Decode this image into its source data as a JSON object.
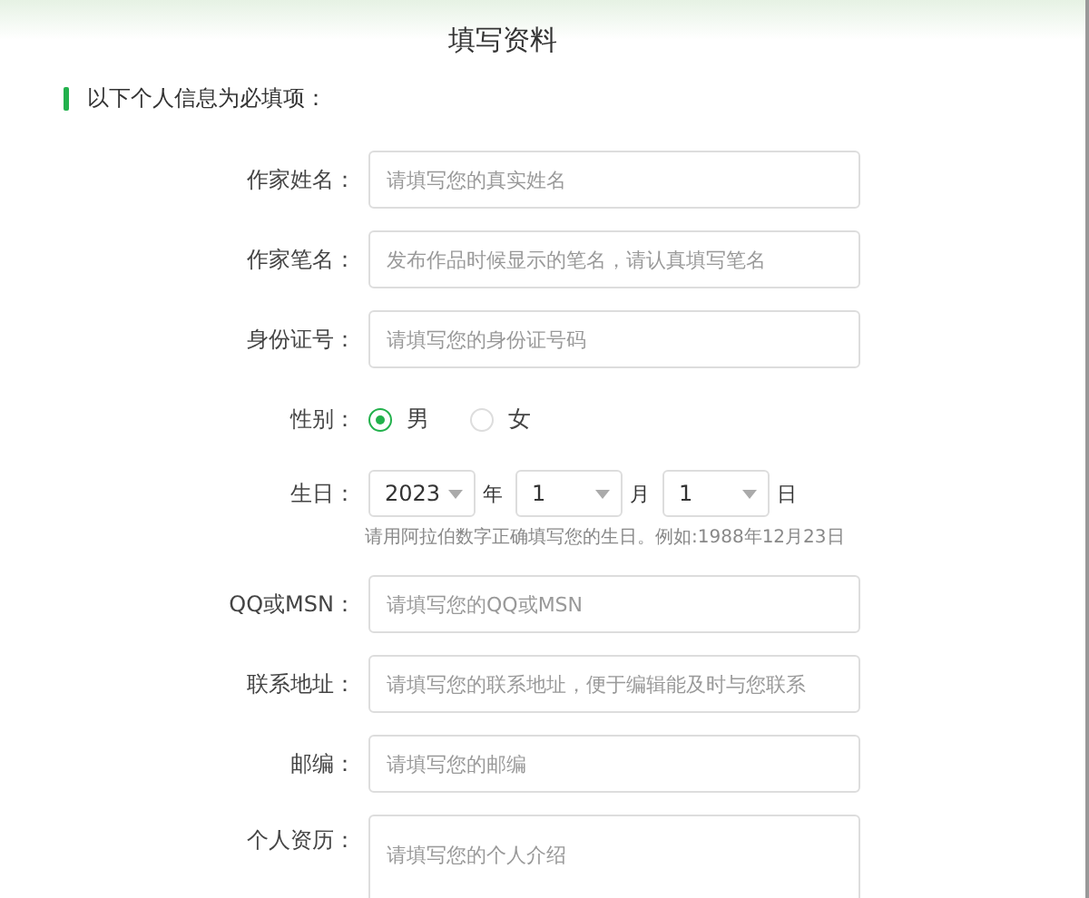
{
  "title": "填写资料",
  "section": "以下个人信息为必填项：",
  "fields": [
    {
      "kind": "text",
      "label": "作家姓名：",
      "placeholder": "请填写您的真实姓名"
    },
    {
      "kind": "text",
      "label": "作家笔名：",
      "placeholder": "发布作品时候显示的笔名，请认真填写笔名"
    },
    {
      "kind": "text",
      "label": "身份证号：",
      "placeholder": "请填写您的身份证号码"
    },
    {
      "kind": "radio",
      "label": "性别：",
      "options": [
        {
          "label": "男",
          "selected": true
        },
        {
          "label": "女",
          "selected": false
        }
      ]
    },
    {
      "kind": "date",
      "label": "生日：",
      "parts": [
        {
          "value": "2023",
          "unit": "年"
        },
        {
          "value": "1",
          "unit": "月"
        },
        {
          "value": "1",
          "unit": "日"
        }
      ],
      "hint": "请用阿拉伯数字正确填写您的生日。例如:1988年12月23日"
    },
    {
      "kind": "text",
      "label": "QQ或MSN：",
      "placeholder": "请填写您的QQ或MSN"
    },
    {
      "kind": "text",
      "label": "联系地址：",
      "placeholder": "请填写您的联系地址，便于编辑能及时与您联系"
    },
    {
      "kind": "text",
      "label": "邮编：",
      "placeholder": "请填写您的邮编"
    },
    {
      "kind": "textarea",
      "label": "个人资历：",
      "placeholder": "请填写您的个人介绍"
    }
  ]
}
